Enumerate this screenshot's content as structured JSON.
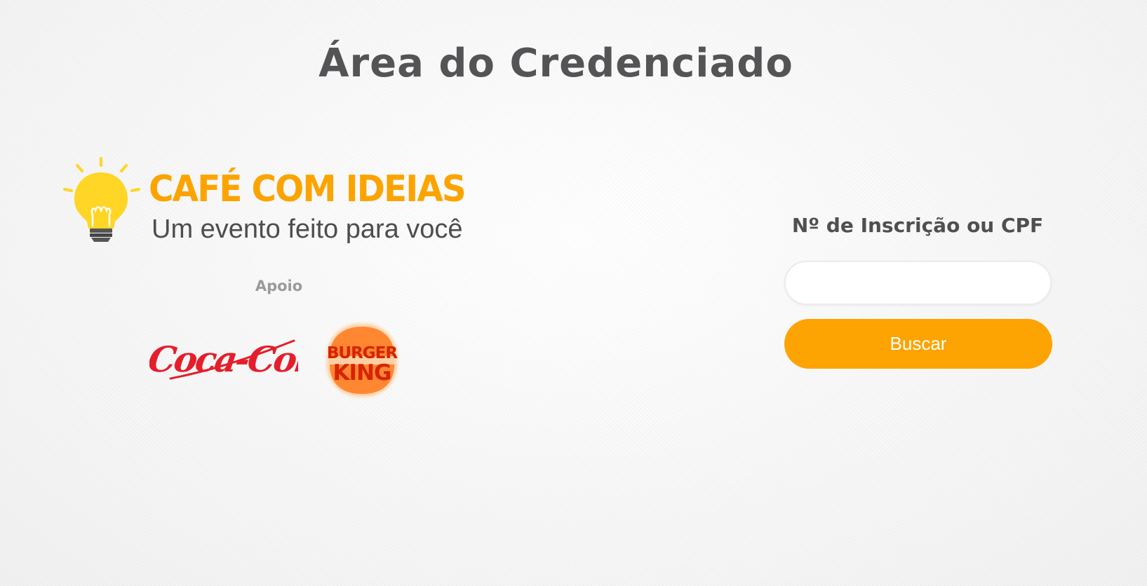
{
  "page": {
    "title": "Área do Credenciado"
  },
  "event_logo": {
    "icon": "lightbulb-icon",
    "name": "CAFÉ COM IDEIAS",
    "tagline": "Um evento feito para você"
  },
  "sponsors": {
    "label": "Apoio",
    "logos": [
      {
        "name": "Coca-Cola",
        "color": "#e41e2b"
      },
      {
        "name": "Burger King",
        "text_line1": "BURGER",
        "text_line2": "KING",
        "color": "#d62300",
        "bun_color": "#ff8732"
      }
    ]
  },
  "search": {
    "label": "Nº de Inscrição ou CPF",
    "input_value": "",
    "button_label": "Buscar"
  },
  "colors": {
    "accent": "#fda302",
    "title_text": "#545456",
    "logo_orange": "#fba400",
    "bulb_yellow": "#ffd526"
  }
}
